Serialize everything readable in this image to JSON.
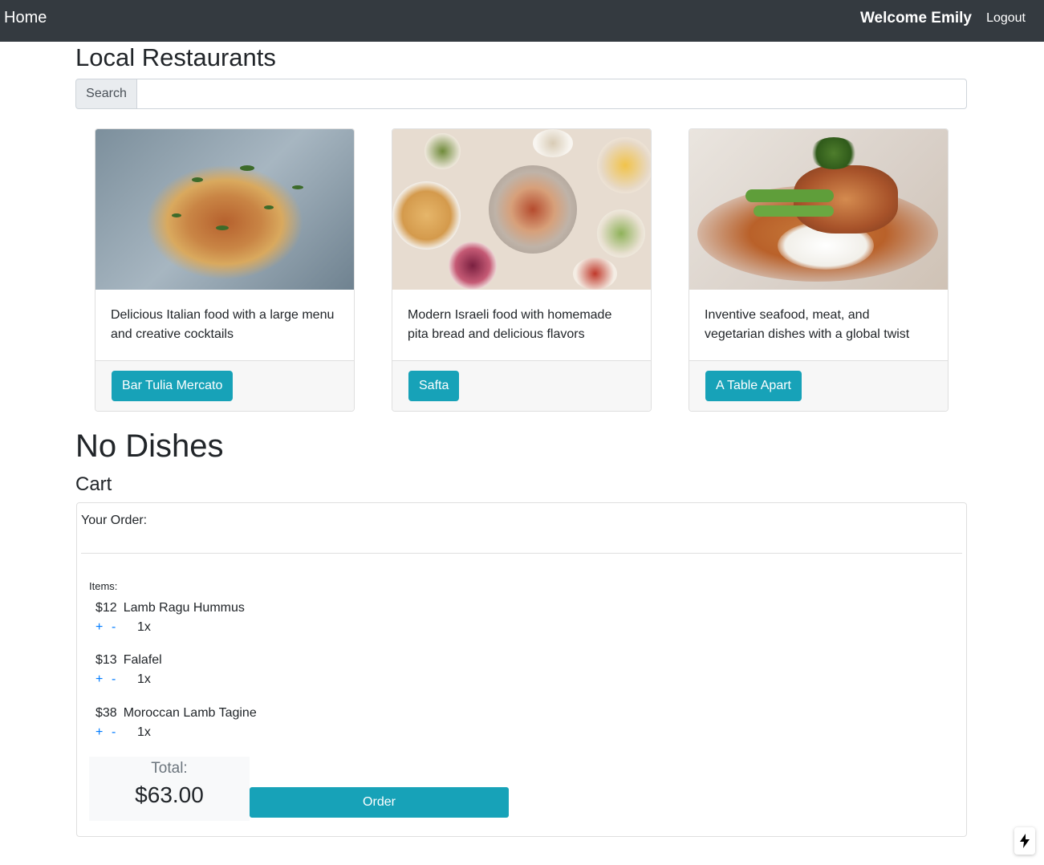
{
  "nav": {
    "home": "Home",
    "welcome": "Welcome Emily",
    "logout": "Logout"
  },
  "page_title": "Local Restaurants",
  "search": {
    "label": "Search",
    "value": "",
    "placeholder": ""
  },
  "restaurants": [
    {
      "description": "Delicious Italian food with a large menu and creative cocktails",
      "button": "Bar Tulia Mercato",
      "image": "pasta-dish-photo"
    },
    {
      "description": "Modern Israeli food with homemade pita bread and delicious flavors",
      "button": "Safta",
      "image": "mezze-spread-photo"
    },
    {
      "description": "Inventive seafood, meat, and vegetarian dishes with a global twist",
      "button": "A Table Apart",
      "image": "seafood-plate-photo"
    }
  ],
  "dishes_heading": "No Dishes",
  "cart": {
    "title": "Cart",
    "header": "Your Order:",
    "items_label": "Items:",
    "items": [
      {
        "price": "$12",
        "name": "Lamb Ragu Hummus",
        "qty": "1x",
        "plus": "+",
        "minus": "-"
      },
      {
        "price": "$13",
        "name": "Falafel",
        "qty": "1x",
        "plus": "+",
        "minus": "-"
      },
      {
        "price": "$38",
        "name": "Moroccan Lamb Tagine",
        "qty": "1x",
        "plus": "+",
        "minus": "-"
      }
    ],
    "total_label": "Total:",
    "total_value": "$63.00",
    "order_button": "Order"
  },
  "colors": {
    "navbar": "#343a40",
    "accent": "#17a2b8",
    "link": "#007bff"
  },
  "corner_badge_icon": "lightning-bolt-icon"
}
